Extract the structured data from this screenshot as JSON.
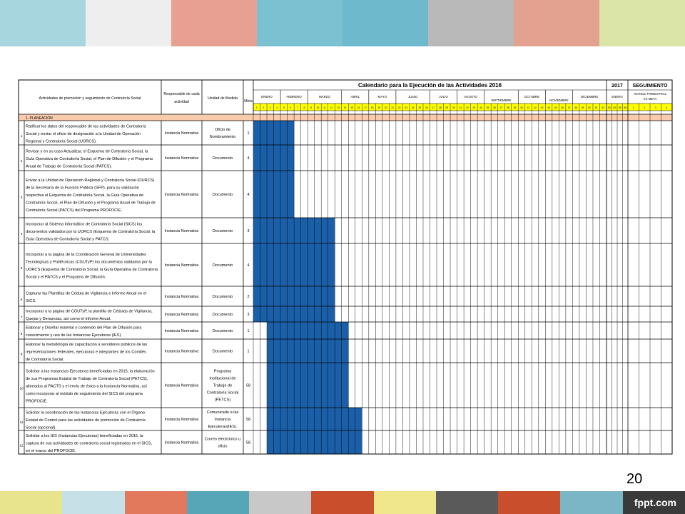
{
  "colors": {
    "top_stripes": [
      "#a8d6df",
      "#eeeeee",
      "#e7a091",
      "#7bc1d2",
      "#6fb9cd",
      "#b9b9b9",
      "#e3a190",
      "#dbe5a8"
    ],
    "bottom_stripes": [
      "#e8e48d",
      "#c6e0e8",
      "#e2795d",
      "#56a6b8",
      "#c8c8c8",
      "#c94e2c",
      "#f0e68c",
      "#5a5a5a",
      "#c94e2c",
      "#7bb6c6",
      "#3a3a3a"
    ],
    "bar_fill": "#1a5fa8",
    "header_yellow": "#ffff00",
    "section_peach": "#f8cbad",
    "grid": "#000000"
  },
  "page_number": "20",
  "brand": "fppt.com",
  "table": {
    "col_activities": "Actividades de promoción y seguimiento de Contraloría Social",
    "col_responsible": "Responsable de cada actividad",
    "col_unit": "Unidad de Medida",
    "col_meta": "Meta",
    "calendar_title": "Calendario para la Ejecución de las Actividades 2016",
    "year_2017": "2017",
    "seguimiento": "SEGUIMIENTO",
    "avance": "AVANCE TRIMESTRAL VS META",
    "months_2016": [
      "ENERO",
      "FEBRERO",
      "MARZO",
      "ABRIL",
      "MAYO",
      "JUNIO",
      "JULIO",
      "AGOSTO",
      "SEPTIEMBRE",
      "OCTUBRE",
      "NOVIEMBRE",
      "DICIEMBRE"
    ],
    "month_2017": "ENERO",
    "week_numbers": [
      "1",
      "2",
      "3",
      "4",
      "5",
      "6",
      "7",
      "8",
      "9",
      "10",
      "11",
      "12",
      "13",
      "14",
      "15",
      "16",
      "17",
      "18",
      "19",
      "20",
      "21",
      "22",
      "23",
      "24",
      "25",
      "26",
      "27",
      "28",
      "29",
      "30",
      "31",
      "32",
      "33",
      "34",
      "35",
      "36",
      "37",
      "38",
      "39",
      "40",
      "41",
      "42",
      "43",
      "44",
      "45",
      "46",
      "47",
      "48",
      "49",
      "50",
      "51",
      "52",
      "53",
      "54",
      "55",
      "56"
    ],
    "quarters": [
      "1",
      "2",
      "3",
      "4"
    ],
    "section": "1. PLANEACIÓN",
    "rows": [
      {
        "num": "1",
        "activity": [
          "Ratificar los datos del responsable de las actividades de Contraloría",
          "Social y enviar el oficio de designación a la Unidad de Operación",
          "Regional y Contraloría Social (UORCS)."
        ],
        "responsible": "Instancia Normativa",
        "unit": [
          "Oficio de",
          "Nombramiento"
        ],
        "meta": "1",
        "weeks": "1–6"
      },
      {
        "num": "2",
        "activity": [
          "Revisar y en su caso Actualizar, el Esquema de Contraloría Social, la",
          "Guía Operativa de Contraloría Social, el Plan de Difusión y el Programa",
          "Anual de Trabajo de Contraloría Social (PATCS)."
        ],
        "responsible": "Instancia Normativa",
        "unit": [
          "Documento"
        ],
        "meta": "4",
        "weeks": "1–6"
      },
      {
        "num": "3",
        "activity": [
          "Enviar a la Unidad de Operación Regional y Contraloría Social (OURCS)",
          "de la Secretaría de la Función Pública (SFP), para su validación",
          "respectiva el Esquema de Contraloría Social, la Guía Operativa de",
          "Contraloría Social, el Plan de Difusión y el Programa Anual de Trabajo de",
          "Contraloría Social (PATCS) del Programa PROFOCIE."
        ],
        "responsible": "Instancia Normativa",
        "unit": [
          "Documento"
        ],
        "meta": "4",
        "weeks": "1–6"
      },
      {
        "num": "4",
        "activity": [
          "Incorporar al Sistema Informático de Contraloría Social (SICS) los",
          "documentos validados por la UORCS (Esquema de Contraloría Social, la",
          "Guía Operativa de Contraloría Social y PATCS."
        ],
        "responsible": "Instancia Normativa",
        "unit": [
          "Documento"
        ],
        "meta": "3",
        "weeks": "1–12"
      },
      {
        "num": "5",
        "activity": [
          "Incorporar a la página de la Coordinación General de Universidades",
          "Tecnológicas y Politécnicas (CGUTyP) los documentos validados por la",
          "UORCS (Esquema de Contraloría Social, la Guía Operativa de Contraloría",
          "Social y el PATCS y el Programa de Difusión."
        ],
        "responsible": "Instancia Normativa",
        "unit": [
          "Documento"
        ],
        "meta": "4",
        "weeks": "1–12"
      },
      {
        "num": "6",
        "activity": [
          "Capturar las Plantillas de Cédula de Vigilancia e Informe Anual en el",
          "SICS."
        ],
        "responsible": "Instancia Normativa",
        "unit": [
          "Documento"
        ],
        "meta": "2",
        "weeks": "1–12"
      },
      {
        "num": "7",
        "activity": [
          "Incorporar a la página de CGUTyP, la plantilla de Cédulas de Vigilancia,",
          "Quejas y Denuncias, así como el Informe Anual."
        ],
        "responsible": "Instancia Normativa",
        "unit": [
          "Documento"
        ],
        "meta": "3",
        "weeks": "1–12"
      },
      {
        "num": "8",
        "activity": [
          "Elaborar y Diseñar material o contenido del Plan de Difusión para",
          "conocimiento y uso de las Instancias Ejecutoras (IES)."
        ],
        "responsible": "Instancia Normativa",
        "unit": [
          "Documento"
        ],
        "meta": "1",
        "weeks": "3–14"
      },
      {
        "num": "9",
        "activity": [
          "Elaborar la metodología de capacitación a servidores públicos de las",
          "representaciones federales, ejecutoras e integrantes de los Comités",
          "de Contraloría Social."
        ],
        "responsible": "Instancia Normativa",
        "unit": [
          "Documento"
        ],
        "meta": "1",
        "weeks": "3–14"
      },
      {
        "num": "10",
        "activity": [
          "Solicitar a las Instancias Ejecutoras beneficiadas en 2015, la elaboración",
          "de sus Programas Estatal de Trabajo de Contraloría Social (PETCS),",
          "alineados al PACTS y el envío de éstos a la Instancia Normativa, así",
          "como incorporar al módulo de seguimiento del SICS del programa",
          "PROFOCIE."
        ],
        "responsible": "Instancia Normativa",
        "unit": [
          "Programa",
          "Institucional de",
          "Trabajo de",
          "Contraloría Social",
          "(PETCS)"
        ],
        "meta": "58",
        "weeks": "3–14"
      },
      {
        "num": "11",
        "activity": [
          "Solicitar la coordinación de las Instancias Ejecutoras con el Órgano",
          "Estatal de Control para las actividades de promoción de Contraloría",
          "Social (opcional)."
        ],
        "responsible": "Instancia Normativa",
        "unit": [
          "Comunicado a las",
          "Instancia",
          "Ejecutoras(IES)."
        ],
        "meta": "58",
        "weeks": "3–16"
      },
      {
        "num": "12",
        "activity": [
          "Solicitar a los IES (Instancias Ejecutoras) beneficiadas en 2016, la",
          "captura de sus actividades de contraloría social registradas en el SICS,",
          "en el marco del PROFOCIE."
        ],
        "responsible": "Instancia Normativa",
        "unit": [
          "Correo electrónico u",
          "oficio"
        ],
        "meta": "58",
        "weeks": "3–16"
      }
    ]
  }
}
